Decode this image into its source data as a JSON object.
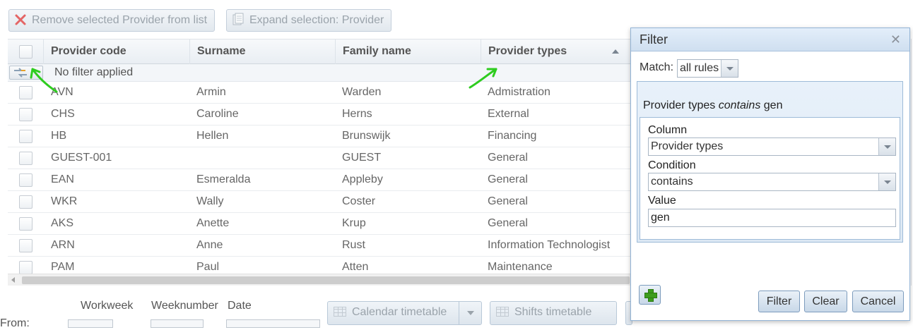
{
  "toolbar": {
    "remove_label": "Remove selected Provider from list",
    "expand_label": "Expand selection: Provider"
  },
  "grid": {
    "columns": [
      "Provider code",
      "Surname",
      "Family name",
      "Provider types"
    ],
    "sort_column": "Provider types",
    "sort_direction": "ascending",
    "filter_text": "No filter applied",
    "rows": [
      [
        "AVN",
        "Armin",
        "Warden",
        "Admistration"
      ],
      [
        "CHS",
        "Caroline",
        "Herns",
        "External"
      ],
      [
        "HB",
        "Hellen",
        "Brunswijk",
        "Financing"
      ],
      [
        "GUEST-001",
        "",
        "GUEST",
        "General"
      ],
      [
        "EAN",
        "Esmeralda",
        "Appleby",
        "General"
      ],
      [
        "WKR",
        "Wally",
        "Coster",
        "General"
      ],
      [
        "AKS",
        "Anette",
        "Krup",
        "General"
      ],
      [
        "ARN",
        "Anne",
        "Rust",
        "Information Technologist"
      ],
      [
        "PAM",
        "Paul",
        "Atten",
        "Maintenance"
      ]
    ]
  },
  "bottom": {
    "labels": [
      "Workweek",
      "Weeknumber",
      "Date"
    ],
    "from_label": "From:",
    "calendar_label": "Calendar timetable",
    "shifts_label": "Shifts timetable"
  },
  "dialog": {
    "title": "Filter",
    "match_label": "Match:",
    "match_value": "all rules",
    "rule_summary": {
      "column": "Provider types",
      "operator": "contains",
      "value": "gen"
    },
    "column_label": "Column",
    "column_value": "Provider types",
    "condition_label": "Condition",
    "condition_value": "contains",
    "value_label": "Value",
    "value_value": "gen",
    "filter_label": "Filter",
    "clear_label": "Clear",
    "cancel_label": "Cancel"
  },
  "colors": {
    "annotation_arrow": "#2ecc1f",
    "dialog_header": "#d8e6f4",
    "remove_icon": "#e46565"
  },
  "icons": [
    "remove-x-icon",
    "expand-document-icon",
    "filter-arrows-icon",
    "sort-up-icon",
    "close-icon",
    "add-rule-plus-icon",
    "calendar-grid-icon"
  ]
}
